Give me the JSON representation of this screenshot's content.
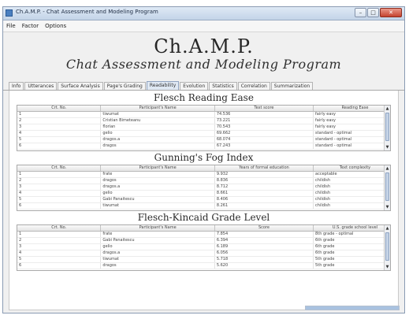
{
  "window": {
    "title": "Ch.A.M.P. - Chat Assessment and Modeling Program",
    "minimize": "–",
    "maximize": "□",
    "close": "✕"
  },
  "menu": [
    "File",
    "Factor",
    "Options"
  ],
  "header": {
    "title": "Ch.A.M.P.",
    "subtitle": "Chat Assessment and Modeling Program"
  },
  "tabs": [
    {
      "label": "Info",
      "active": false
    },
    {
      "label": "Utterances",
      "active": false
    },
    {
      "label": "Surface Analysis",
      "active": false
    },
    {
      "label": "Page's Grading",
      "active": false
    },
    {
      "label": "Readability",
      "active": true
    },
    {
      "label": "Evolution",
      "active": false
    },
    {
      "label": "Statistics",
      "active": false
    },
    {
      "label": "Correlation",
      "active": false
    },
    {
      "label": "Summarization",
      "active": false
    }
  ],
  "sections": [
    {
      "title": "Flesch Reading Ease",
      "headers": [
        "Crt. No.",
        "Participant's Name",
        "Text score",
        "Reading Ease"
      ],
      "rows": [
        [
          "1",
          "tiwumat",
          "74.536",
          "fairly easy"
        ],
        [
          "2",
          "Cristian Bimeteanu",
          "73.221",
          "fairly easy"
        ],
        [
          "3",
          "florian",
          "70.543",
          "fairly easy"
        ],
        [
          "4",
          "gelio",
          "69.662",
          "standard - optimal"
        ],
        [
          "5",
          "dragos.a",
          "68.074",
          "standard - optimal"
        ],
        [
          "6",
          "dragos",
          "67.243",
          "standard - optimal"
        ]
      ]
    },
    {
      "title": "Gunning's Fog Index",
      "headers": [
        "Crt. No.",
        "Participant's Name",
        "Years of formal education",
        "Text complexity"
      ],
      "rows": [
        [
          "1",
          "frate",
          "9.932",
          "acceptable"
        ],
        [
          "2",
          "dragos",
          "8.836",
          "childish"
        ],
        [
          "3",
          "dragos.a",
          "8.712",
          "childish"
        ],
        [
          "4",
          "gelio",
          "8.661",
          "childish"
        ],
        [
          "5",
          "Gabi Panaitescu",
          "8.406",
          "childish"
        ],
        [
          "6",
          "tiwumat",
          "8.261",
          "childish"
        ]
      ]
    },
    {
      "title": "Flesch-Kincaid Grade Level",
      "headers": [
        "Crt. No.",
        "Participant's Name",
        "Score",
        "U.S. grade school level"
      ],
      "rows": [
        [
          "1",
          "frate",
          "7.854",
          "8th grade - optimal"
        ],
        [
          "2",
          "Gabi Panaitescu",
          "6.394",
          "6th grade"
        ],
        [
          "3",
          "gelio",
          "6.189",
          "6th grade"
        ],
        [
          "4",
          "dragos.a",
          "6.056",
          "6th grade"
        ],
        [
          "5",
          "tiwumat",
          "5.718",
          "5th grade"
        ],
        [
          "6",
          "dragos",
          "5.620",
          "5th grade"
        ]
      ]
    }
  ],
  "scroll": {
    "up": "▲",
    "down": "▼"
  },
  "status": {
    "progress_fraction": 1.0
  }
}
